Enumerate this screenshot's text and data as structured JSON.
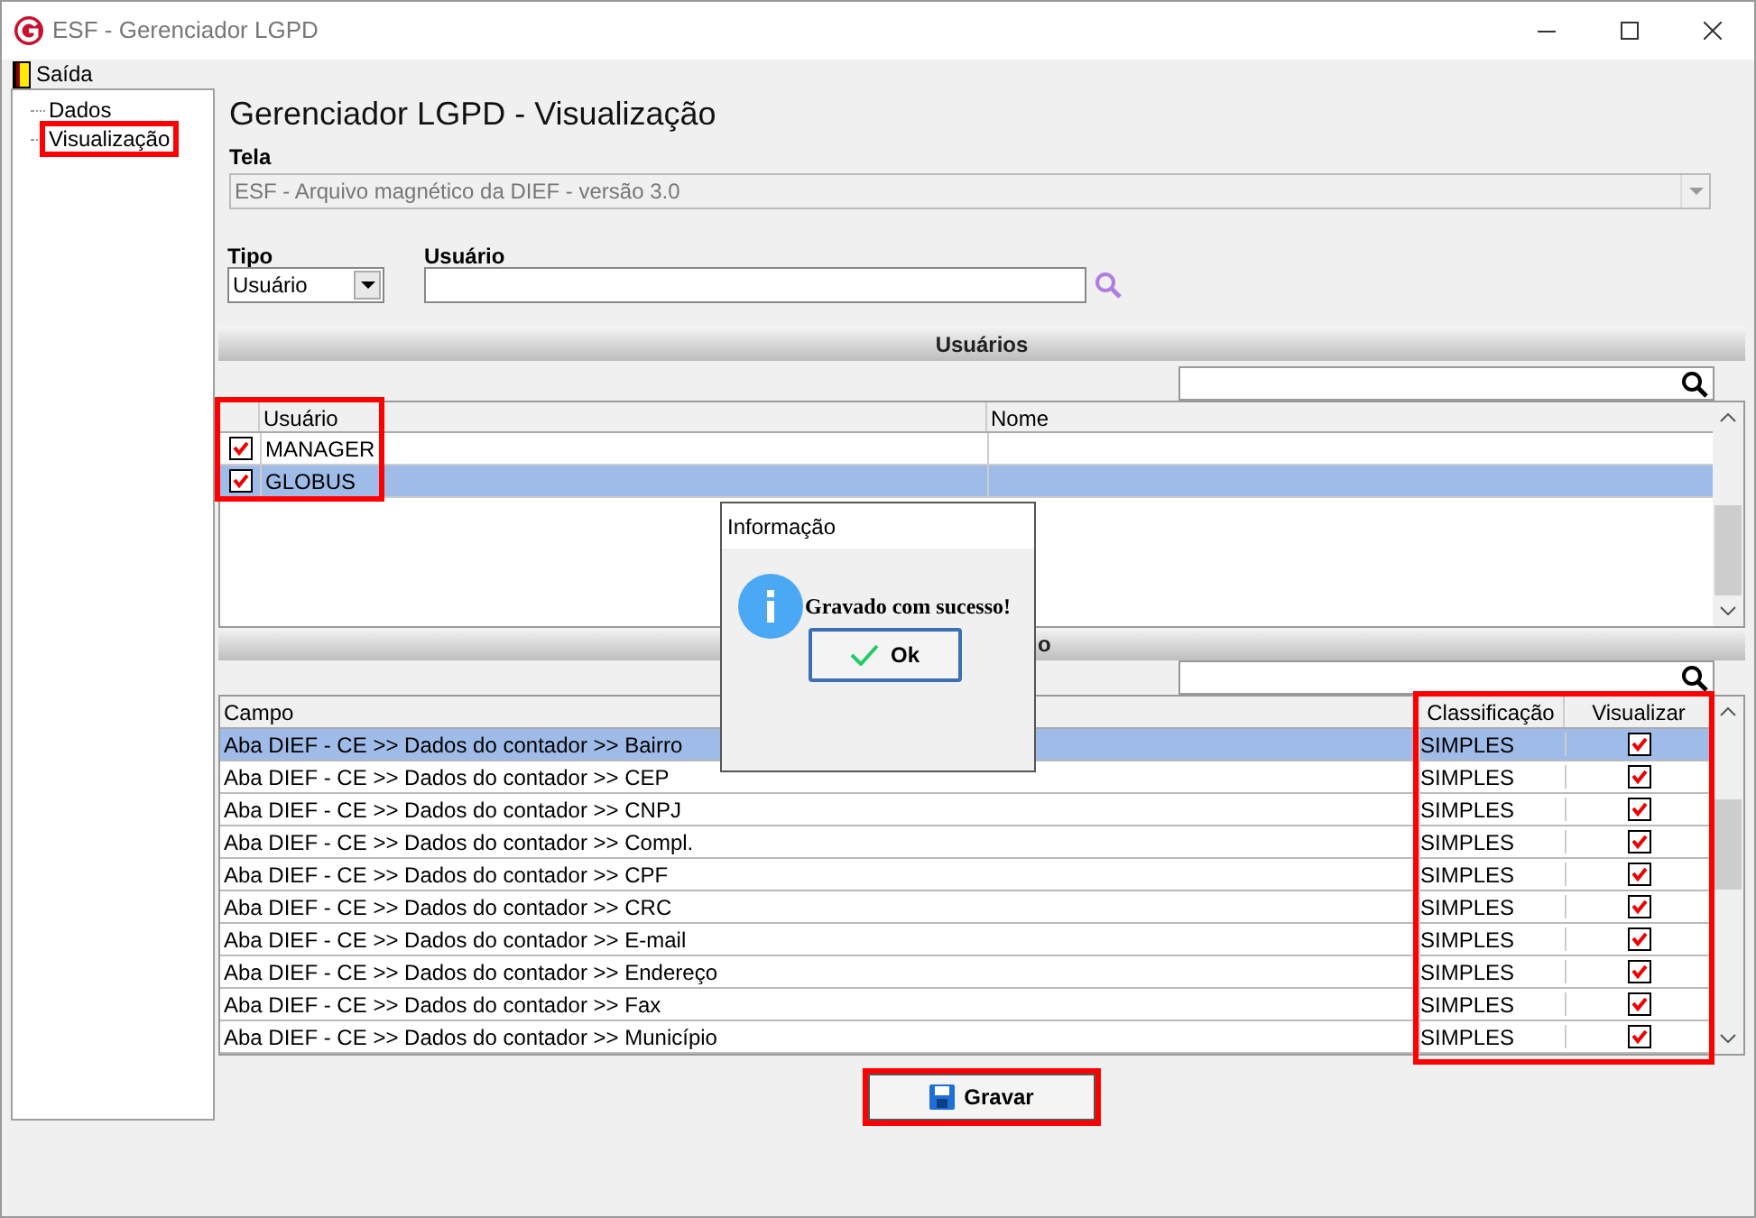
{
  "window": {
    "title": "ESF - Gerenciador LGPD"
  },
  "menu": [
    {
      "label": "Saída"
    }
  ],
  "tree": [
    {
      "label": "Dados",
      "highlighted": false
    },
    {
      "label": "Visualização",
      "highlighted": true
    }
  ],
  "heading": "Gerenciador LGPD - Visualização",
  "tela": {
    "label": "Tela",
    "value": "ESF - Arquivo magnético da DIEF - versão 3.0",
    "disabled": true
  },
  "tipo": {
    "label": "Tipo",
    "value": "Usuário"
  },
  "usuario": {
    "label": "Usuário"
  },
  "users": {
    "section": "Usuários",
    "highlighted": true,
    "columns": [
      "Usuário",
      "Nome"
    ],
    "rows": [
      {
        "usuario": "MANAGER",
        "checked": true,
        "selected": false
      },
      {
        "usuario": "GLOBUS",
        "checked": true,
        "selected": true
      }
    ]
  },
  "fields": {
    "section": "o",
    "highlighted": true,
    "columns": [
      "Campo",
      "Classificação",
      "Visualizar"
    ],
    "rows": [
      {
        "campo": "Aba DIEF - CE >> Dados do contador >> Bairro",
        "classificacao": "SIMPLES",
        "checked": true,
        "selected": true
      },
      {
        "campo": "Aba DIEF - CE >> Dados do contador >> CEP",
        "classificacao": "SIMPLES",
        "checked": true,
        "selected": false
      },
      {
        "campo": "Aba DIEF - CE >> Dados do contador >> CNPJ",
        "classificacao": "SIMPLES",
        "checked": true,
        "selected": false
      },
      {
        "campo": "Aba DIEF - CE >> Dados do contador >> Compl.",
        "classificacao": "SIMPLES",
        "checked": true,
        "selected": false
      },
      {
        "campo": "Aba DIEF - CE >> Dados do contador >> CPF",
        "classificacao": "SIMPLES",
        "checked": true,
        "selected": false
      },
      {
        "campo": "Aba DIEF - CE >> Dados do contador >> CRC",
        "classificacao": "SIMPLES",
        "checked": true,
        "selected": false
      },
      {
        "campo": "Aba DIEF - CE >> Dados do contador >> E-mail",
        "classificacao": "SIMPLES",
        "checked": true,
        "selected": false
      },
      {
        "campo": "Aba DIEF - CE >> Dados do contador >> Endereço",
        "classificacao": "SIMPLES",
        "checked": true,
        "selected": false
      },
      {
        "campo": "Aba DIEF - CE >> Dados do contador >> Fax",
        "classificacao": "SIMPLES",
        "checked": true,
        "selected": false
      },
      {
        "campo": "Aba DIEF - CE >> Dados do contador >> Município",
        "classificacao": "SIMPLES",
        "checked": true,
        "selected": false
      }
    ]
  },
  "save_button": {
    "label": "Gravar",
    "highlighted": true
  },
  "dialog": {
    "title": "Informação",
    "message": "Gravado com sucesso!",
    "button": "Ok"
  }
}
